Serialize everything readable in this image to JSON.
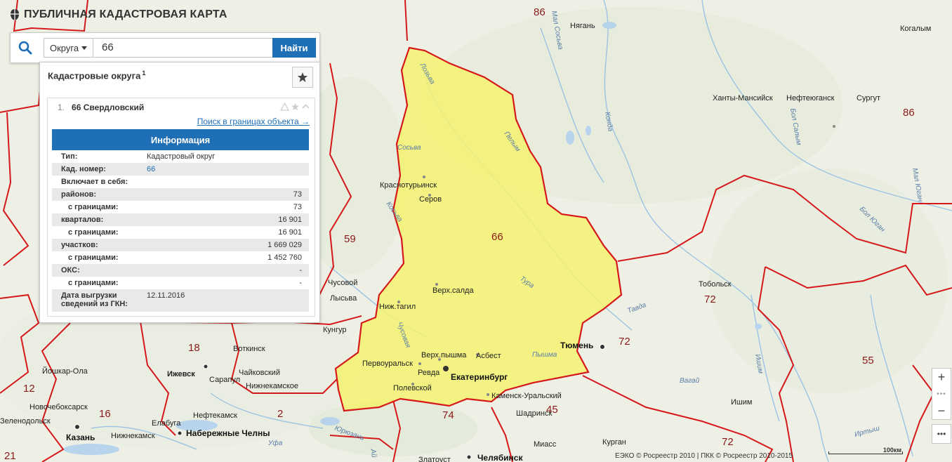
{
  "app": {
    "title": "ПУБЛИЧНАЯ КАДАСТРОВАЯ КАРТА"
  },
  "search": {
    "category": "Округа",
    "query": "66",
    "clear": "×",
    "submit_label": "Найти"
  },
  "panel": {
    "title": "Кадастровые округа",
    "count": "1",
    "result": {
      "index": "1.",
      "name": "66 Свердловский",
      "search_link": "Поиск в границах объекта →",
      "info_title": "Информация",
      "rows": [
        {
          "key": "Тип:",
          "value": "Кадастровый округ"
        },
        {
          "key": "Кад. номер:",
          "value": "66"
        },
        {
          "key": "Включает в себя:",
          "value": ""
        },
        {
          "key": "районов:",
          "value": "73"
        },
        {
          "key": "с границами:",
          "value": "73"
        },
        {
          "key": "кварталов:",
          "value": "16 901"
        },
        {
          "key": "с границами:",
          "value": "16 901"
        },
        {
          "key": "участков:",
          "value": "1 669 029"
        },
        {
          "key": "с границами:",
          "value": "1 452 760"
        },
        {
          "key": "ОКС:",
          "value": "-"
        },
        {
          "key": "с границами:",
          "value": "-"
        },
        {
          "key": "Дата выгрузки сведений из ГКН:",
          "value": "12.11.2016"
        }
      ]
    }
  },
  "map": {
    "highlight_color": "#f5f270",
    "boundary_color": "#d6181a",
    "region_numbers": [
      "86",
      "86",
      "66",
      "59",
      "72",
      "72",
      "72",
      "18",
      "12",
      "16",
      "2",
      "74",
      "45",
      "55",
      "21"
    ],
    "cities": [
      "Нягань",
      "Ханты-Мансийск",
      "Нефтеюганск",
      "Сургут",
      "Когалым",
      "Краснотурьинск",
      "Серов",
      "Верх.салда",
      "Ниж.тагил",
      "Первоуральск",
      "Ревда",
      "Верх.пышма",
      "Асбест",
      "Полевской",
      "Каменск-Уральский",
      "Тобольск",
      "Кунгур",
      "Лысьва",
      "Чусовой",
      "Воткинск",
      "Ижевск",
      "Сарапул",
      "Чайковский",
      "Нижнекамское",
      "Нефтекамск",
      "Йошкар-Ола",
      "Новочебоксарск",
      "Зеленодольск",
      "Нижнекамск",
      "Елабуга",
      "Шадринск",
      "Курган",
      "Ишим",
      "Златоуст",
      "Миасс"
    ],
    "big_cities": [
      "Екатеринбург",
      "Тюмень",
      "Казань",
      "Набережные Челны",
      "Челябинск"
    ],
    "rivers": [
      "Лозьва",
      "Сосьва",
      "Пелым",
      "Косьва",
      "Тура",
      "Тавда",
      "Чусовая",
      "Пышма",
      "Вагай",
      "Ишим",
      "Иртыш",
      "Уфа",
      "Юрюзань",
      "Мал Сосьва",
      "Конда",
      "Бол Юган",
      "Мал Юган",
      "Бол Салым",
      "Ай"
    ],
    "footer": "ЕЭКО © Росреестр 2010 | ПКК © Росреестр 2010-2015",
    "scale_label": "100км"
  },
  "controls": {
    "zoom_in": "+",
    "zoom_out": "−",
    "more": "•••"
  }
}
